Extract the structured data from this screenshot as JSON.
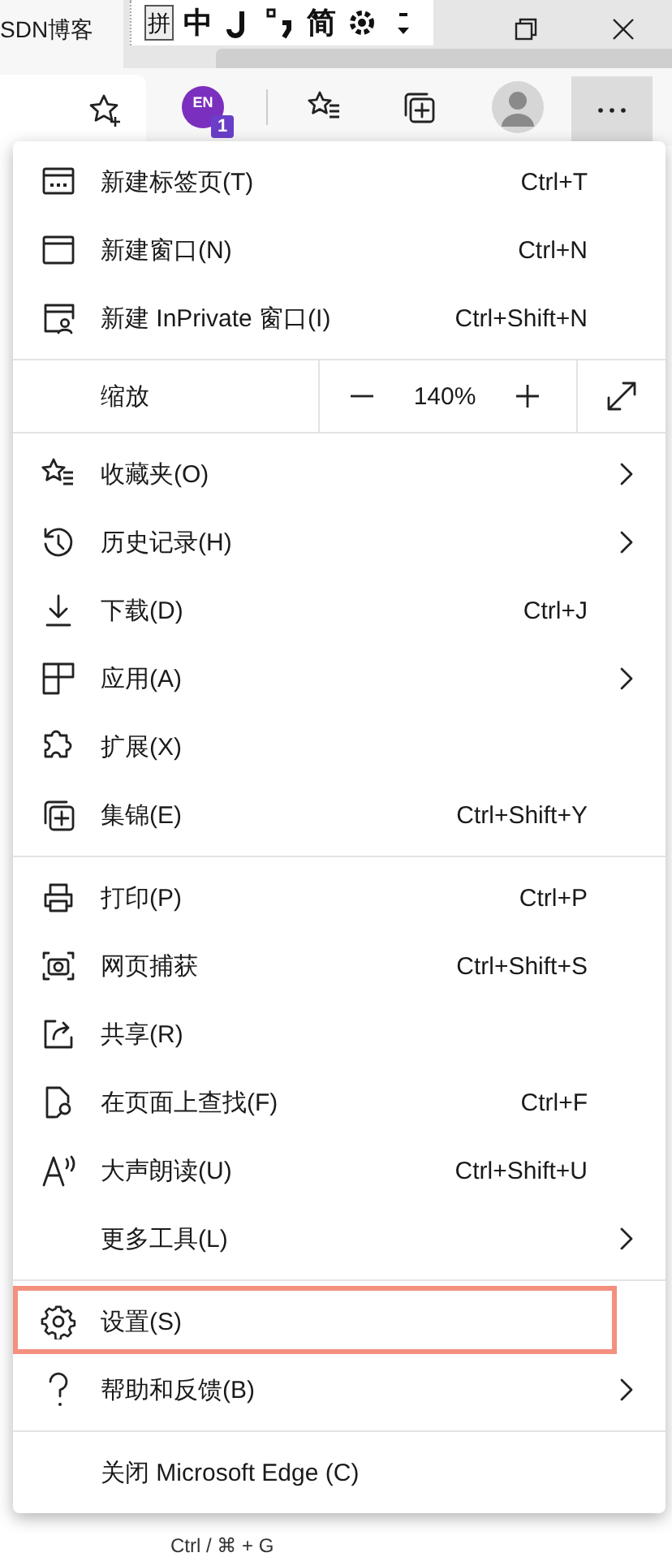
{
  "title_bar": {
    "tab_title": "SDN博客",
    "ime_toolbar": [
      {
        "kind": "boxed",
        "text": "拼"
      },
      {
        "kind": "text",
        "text": "中"
      },
      {
        "kind": "icon"
      },
      {
        "kind": "icon"
      },
      {
        "kind": "text",
        "text": "简"
      },
      {
        "kind": "icon"
      },
      {
        "kind": "icon"
      }
    ]
  },
  "toolbar": {
    "extension_badge": {
      "text": "EN",
      "count": "1"
    }
  },
  "page_behind": {
    "text": "Ctrl / ⌘ + G"
  },
  "menu": {
    "sections": [
      [
        {
          "kind": "item",
          "label": "新建标签页(T)",
          "shortcut": "Ctrl+T",
          "submenu": false,
          "highlighted": false
        },
        {
          "kind": "item",
          "label": "新建窗口(N)",
          "shortcut": "Ctrl+N",
          "submenu": false,
          "highlighted": false
        },
        {
          "kind": "item",
          "label": "新建 InPrivate 窗口(I)",
          "shortcut": "Ctrl+Shift+N",
          "submenu": false,
          "highlighted": false
        }
      ],
      [
        {
          "kind": "zoom",
          "label": "缩放",
          "value": "140%"
        }
      ],
      [
        {
          "kind": "item",
          "label": "收藏夹(O)",
          "submenu": true,
          "highlighted": false
        },
        {
          "kind": "item",
          "label": "历史记录(H)",
          "submenu": true,
          "highlighted": false
        },
        {
          "kind": "item",
          "label": "下载(D)",
          "shortcut": "Ctrl+J",
          "submenu": false,
          "highlighted": false
        },
        {
          "kind": "item",
          "label": "应用(A)",
          "submenu": true,
          "highlighted": false
        },
        {
          "kind": "item",
          "label": "扩展(X)",
          "submenu": false,
          "highlighted": false
        },
        {
          "kind": "item",
          "label": "集锦(E)",
          "shortcut": "Ctrl+Shift+Y",
          "submenu": false,
          "highlighted": false
        }
      ],
      [
        {
          "kind": "item",
          "label": "打印(P)",
          "shortcut": "Ctrl+P",
          "submenu": false,
          "highlighted": false
        },
        {
          "kind": "item",
          "label": "网页捕获",
          "shortcut": "Ctrl+Shift+S",
          "submenu": false,
          "highlighted": false
        },
        {
          "kind": "item",
          "label": "共享(R)",
          "submenu": false,
          "highlighted": false
        },
        {
          "kind": "item",
          "label": "在页面上查找(F)",
          "shortcut": "Ctrl+F",
          "submenu": false,
          "highlighted": false
        },
        {
          "kind": "item",
          "label": "大声朗读(U)",
          "shortcut": "Ctrl+Shift+U",
          "submenu": false,
          "highlighted": false
        },
        {
          "kind": "item",
          "label": "更多工具(L)",
          "submenu": true,
          "highlighted": false
        }
      ],
      [
        {
          "kind": "item",
          "label": "设置(S)",
          "submenu": false,
          "highlighted": true
        },
        {
          "kind": "item",
          "label": "帮助和反馈(B)",
          "submenu": true,
          "highlighted": false
        }
      ],
      [
        {
          "kind": "item",
          "label": "关闭 Microsoft Edge (C)",
          "submenu": false,
          "highlighted": false
        }
      ]
    ]
  }
}
